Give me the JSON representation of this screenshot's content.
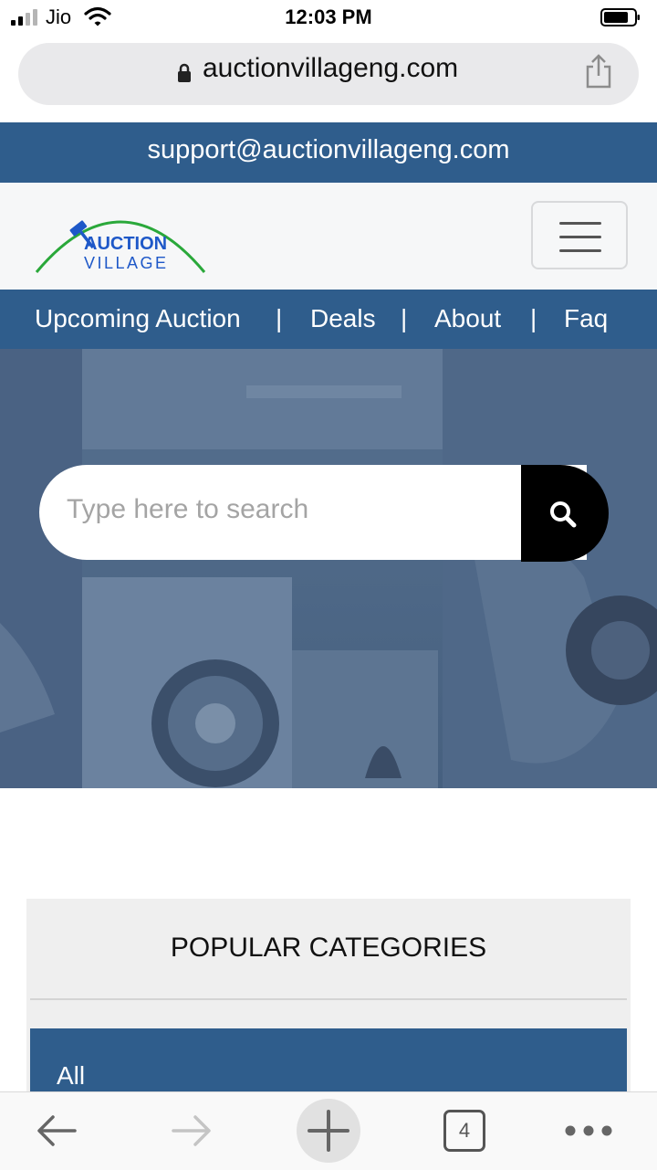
{
  "status_bar": {
    "carrier": "Jio",
    "time": "12:03 PM"
  },
  "browser": {
    "url": "auctionvillageng.com",
    "tab_count": "4"
  },
  "support": {
    "email": "support@auctionvillageng.com"
  },
  "logo": {
    "line1": "AUCTION",
    "line2": "VILLAGE",
    "arc_color": "#2aa83a",
    "text_color": "#1e58c8"
  },
  "nav": {
    "items": [
      "Upcoming Auction",
      "Deals",
      "About",
      "Faq"
    ],
    "separator": "|"
  },
  "search": {
    "placeholder": "Type here to search"
  },
  "categories": {
    "title": "POPULAR CATEGORIES",
    "items": [
      "All"
    ]
  },
  "colors": {
    "brand_blue": "#2f5d8c",
    "header_bg": "#f6f7f8",
    "search_button": "#000000"
  }
}
